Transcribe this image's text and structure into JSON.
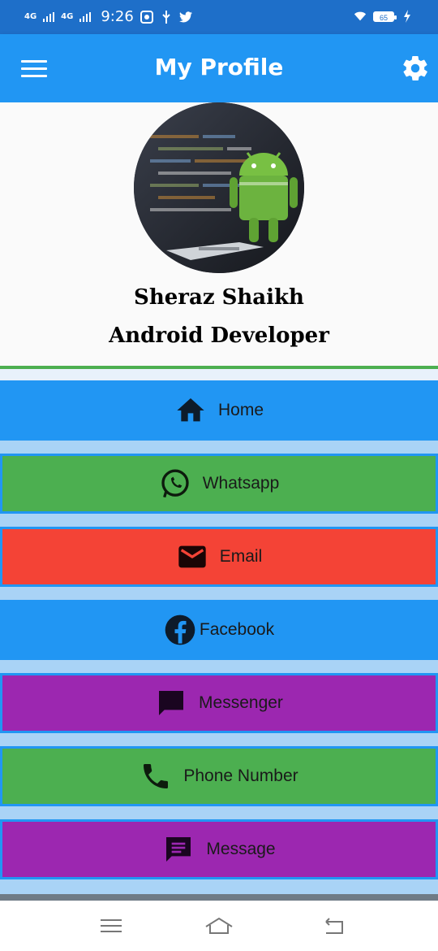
{
  "status_bar": {
    "net1": "4G",
    "net2": "4G",
    "time": "9:26",
    "battery": "65"
  },
  "app_bar": {
    "title": "My Profile",
    "menu_icon": "hamburger-menu-icon",
    "settings_icon": "gear-icon"
  },
  "profile": {
    "name": "Sheraz Shaikh",
    "role": "Android Developer"
  },
  "menu": [
    {
      "label": "Home",
      "icon": "home-icon",
      "color": "#2196f3"
    },
    {
      "label": "Whatsapp",
      "icon": "whatsapp-icon",
      "color": "#4caf50"
    },
    {
      "label": "Email",
      "icon": "email-icon",
      "color": "#f44336"
    },
    {
      "label": "Facebook",
      "icon": "facebook-icon",
      "color": "#2196f3"
    },
    {
      "label": "Messenger",
      "icon": "messenger-icon",
      "color": "#9c27b0"
    },
    {
      "label": "Phone Number",
      "icon": "phone-icon",
      "color": "#4caf50"
    },
    {
      "label": "Message",
      "icon": "message-icon",
      "color": "#9c27b0"
    }
  ],
  "colors": {
    "status_bar": "#1e6fc9",
    "app_bar": "#2196f3",
    "divider": "#4caf50"
  }
}
